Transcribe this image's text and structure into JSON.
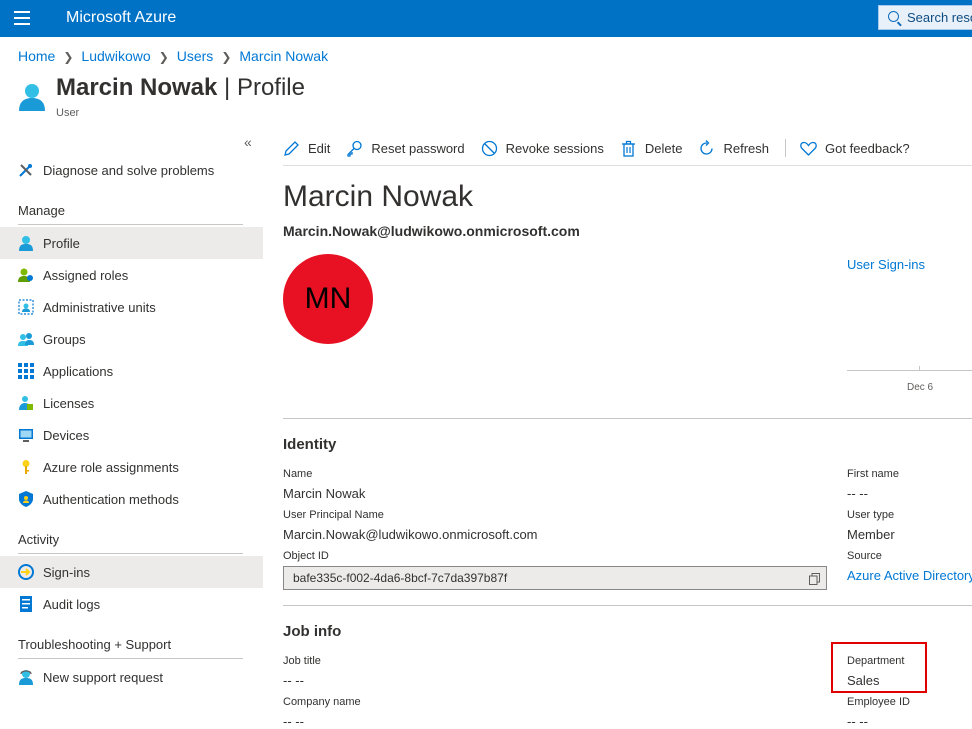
{
  "app": {
    "brand": "Microsoft Azure",
    "search_placeholder": "Search reso"
  },
  "breadcrumb": [
    "Home",
    "Ludwikowo",
    "Users",
    "Marcin Nowak"
  ],
  "header": {
    "title": "Marcin Nowak",
    "title_suffix": " | Profile",
    "subtitle": "User"
  },
  "sidebar": {
    "collapse_glyph": "«",
    "diagnose": "Diagnose and solve problems",
    "manage_heading": "Manage",
    "manage_items": [
      "Profile",
      "Assigned roles",
      "Administrative units",
      "Groups",
      "Applications",
      "Licenses",
      "Devices",
      "Azure role assignments",
      "Authentication methods"
    ],
    "activity_heading": "Activity",
    "activity_items": [
      "Sign-ins",
      "Audit logs"
    ],
    "support_heading": "Troubleshooting + Support",
    "support_items": [
      "New support request"
    ]
  },
  "toolbar": {
    "edit": "Edit",
    "reset_password": "Reset password",
    "revoke_sessions": "Revoke sessions",
    "delete": "Delete",
    "refresh": "Refresh",
    "feedback": "Got feedback?"
  },
  "profile": {
    "name": "Marcin Nowak",
    "email": "Marcin.Nowak@ludwikowo.onmicrosoft.com",
    "initials": "MN",
    "avatar_color": "#e81123",
    "signins_link": "User Sign-ins",
    "chart_tick": "Dec 6"
  },
  "identity": {
    "heading": "Identity",
    "name_label": "Name",
    "name_value": "Marcin Nowak",
    "upn_label": "User Principal Name",
    "upn_value": "Marcin.Nowak@ludwikowo.onmicrosoft.com",
    "objid_label": "Object ID",
    "objid_value": "bafe335c-f002-4da6-8bcf-7c7da397b87f",
    "first_name_label": "First name",
    "first_name_value": "-- --",
    "user_type_label": "User type",
    "user_type_value": "Member",
    "source_label": "Source",
    "source_value": "Azure Active Directory"
  },
  "job": {
    "heading": "Job info",
    "job_title_label": "Job title",
    "job_title_value": "-- --",
    "company_label": "Company name",
    "company_value": "-- --",
    "department_label": "Department",
    "department_value": "Sales",
    "employee_id_label": "Employee ID",
    "employee_id_value": "-- --"
  }
}
